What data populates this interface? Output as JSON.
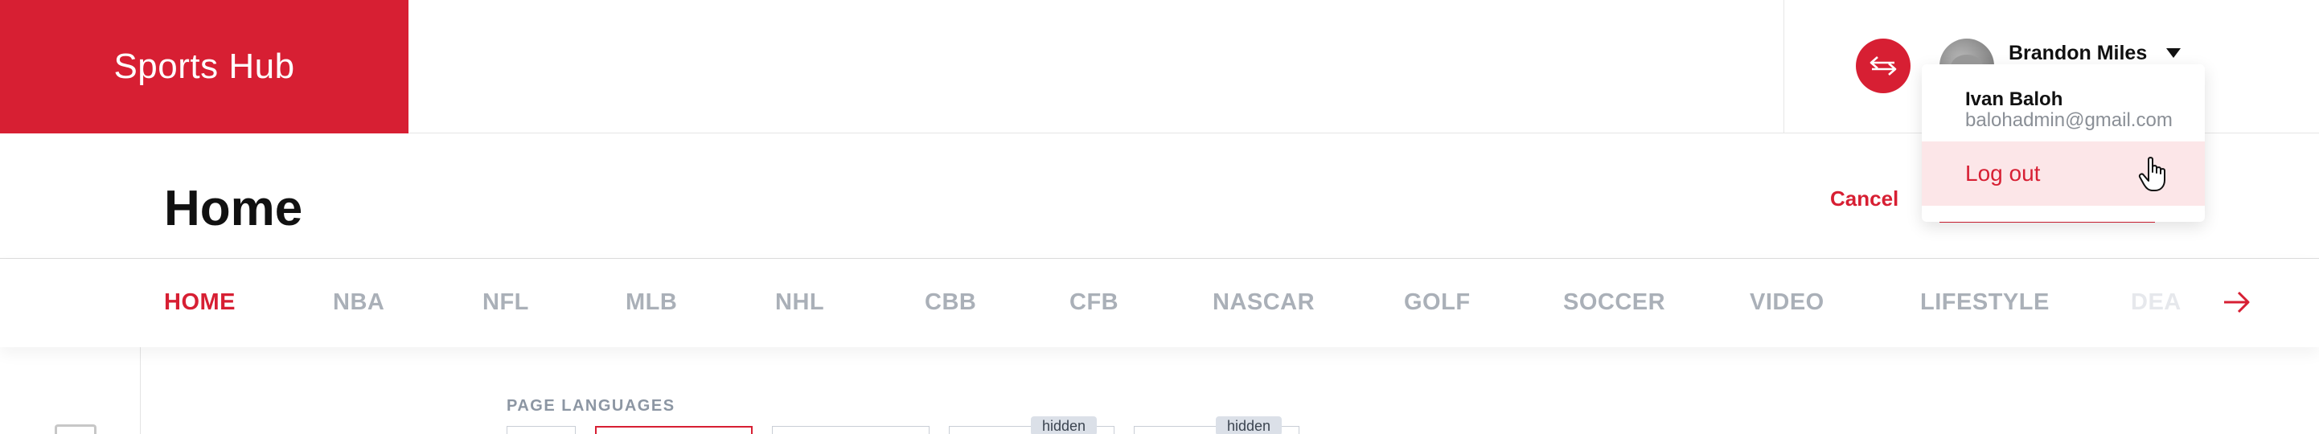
{
  "app": {
    "logo_text": "Sports Hub"
  },
  "header": {
    "user_name": "Brandon Miles"
  },
  "dropdown": {
    "name": "Ivan Baloh",
    "email": "balohadmin@gmail.com",
    "logout_label": "Log out"
  },
  "page": {
    "title": "Home",
    "cancel_label": "Cancel"
  },
  "nav": {
    "items": [
      {
        "label": "HOME",
        "active": true
      },
      {
        "label": "NBA"
      },
      {
        "label": "NFL"
      },
      {
        "label": "MLB"
      },
      {
        "label": "NHL"
      },
      {
        "label": "CBB"
      },
      {
        "label": "CFB"
      },
      {
        "label": "NASCAR"
      },
      {
        "label": "GOLF"
      },
      {
        "label": "SOCCER"
      },
      {
        "label": "VIDEO"
      },
      {
        "label": "LIFESTYLE"
      },
      {
        "label": "DEA"
      }
    ]
  },
  "content": {
    "section_label": "PAGE LANGUAGES",
    "badges": [
      "hidden",
      "hidden"
    ]
  },
  "colors": {
    "brand": "#d71f33",
    "nav_inactive": "#aab0b8",
    "logout_bg": "#fce6e8"
  },
  "icons": {
    "switch": "swap-arrows-icon",
    "caret": "caret-down-icon",
    "next": "arrow-right-icon",
    "cursor": "hand-pointer-icon"
  }
}
